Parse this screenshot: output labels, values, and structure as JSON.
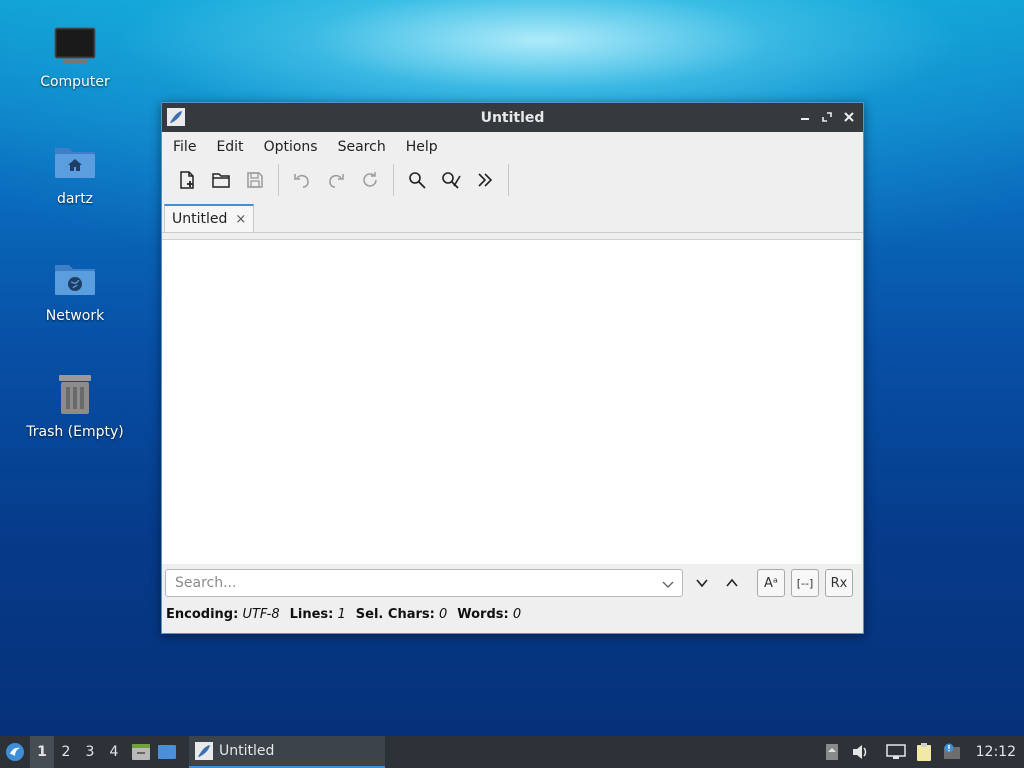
{
  "desktop": {
    "icons": [
      {
        "label": "Computer",
        "icon": "computer-icon"
      },
      {
        "label": "dartz",
        "icon": "home-folder-icon"
      },
      {
        "label": "Network",
        "icon": "network-folder-icon"
      },
      {
        "label": "Trash (Empty)",
        "icon": "trash-icon"
      }
    ]
  },
  "window": {
    "title": "Untitled",
    "menu": [
      "File",
      "Edit",
      "Options",
      "Search",
      "Help"
    ],
    "toolbar": [
      "new-file-icon",
      "open-folder-icon",
      "save-icon",
      "undo-icon",
      "redo-icon",
      "reload-icon",
      "find-icon",
      "replace-icon",
      "more-icon"
    ],
    "tab": {
      "label": "Untitled",
      "close": "×"
    },
    "search": {
      "placeholder": "Search...",
      "value": ""
    },
    "status": {
      "encoding_label": "Encoding:",
      "encoding_value": "UTF-8",
      "lines_label": "Lines:",
      "lines_value": "1",
      "selchars_label": "Sel. Chars:",
      "selchars_value": "0",
      "words_label": "Words:",
      "words_value": "0"
    },
    "search_options": [
      "Aᵃ",
      "[--]",
      "Rx"
    ]
  },
  "taskbar": {
    "workspaces": [
      "1",
      "2",
      "3",
      "4"
    ],
    "active_workspace": "1",
    "task_label": "Untitled",
    "clock": "12:12",
    "accent": "#3d8fd9"
  }
}
